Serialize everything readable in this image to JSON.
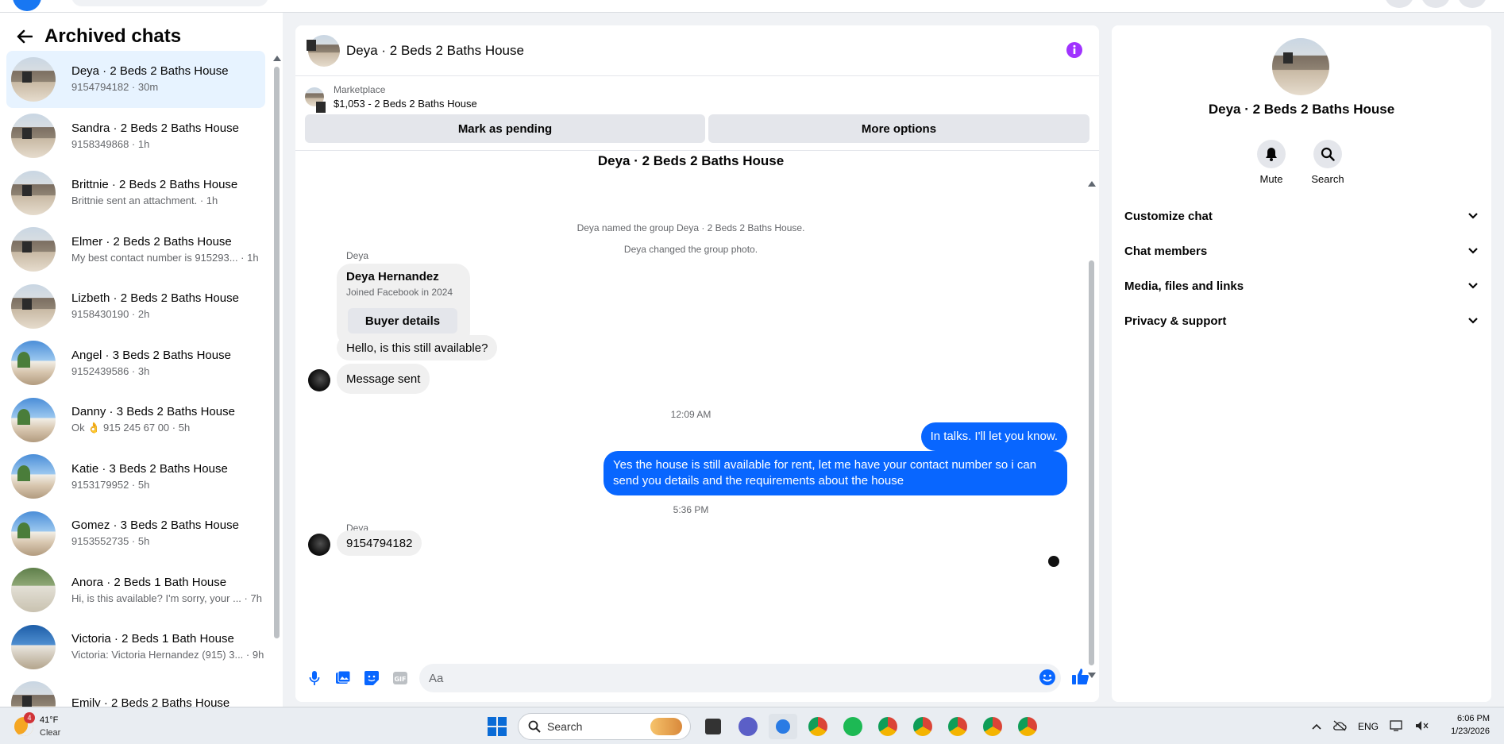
{
  "sidebar": {
    "title": "Archived chats",
    "chats": [
      {
        "name": "Deya · 2 Beds 2 Baths House",
        "sub": "9154794182 · 30m",
        "avatar": "house",
        "active": true
      },
      {
        "name": "Sandra · 2 Beds 2 Baths House",
        "sub": "9158349868 · 1h",
        "avatar": "house"
      },
      {
        "name": "Brittnie · 2 Beds 2 Baths House",
        "sub": "Brittnie sent an attachment. · 1h",
        "avatar": "house"
      },
      {
        "name": "Elmer · 2 Beds 2 Baths House",
        "sub": "My best contact number is 915293... · 1h",
        "avatar": "house"
      },
      {
        "name": "Lizbeth · 2 Beds 2 Baths House",
        "sub": "9158430190 · 2h",
        "avatar": "house"
      },
      {
        "name": "Angel · 3 Beds 2 Baths House",
        "sub": "9152439586 · 3h",
        "avatar": "blue"
      },
      {
        "name": "Danny · 3 Beds 2 Baths House",
        "sub": "Ok 👌 915 245 67 00 · 5h",
        "avatar": "blue"
      },
      {
        "name": "Katie · 3 Beds 2 Baths House",
        "sub": "9153179952 · 5h",
        "avatar": "blue"
      },
      {
        "name": "Gomez · 3 Beds 2 Baths House",
        "sub": "9153552735 · 5h",
        "avatar": "blue"
      },
      {
        "name": "Anora · 2 Beds 1 Bath House",
        "sub": "Hi, is this available? I'm sorry, your ... · 7h",
        "avatar": "green"
      },
      {
        "name": "Victoria · 2 Beds 1 Bath House",
        "sub": "Victoria: Victoria Hernandez (915) 3... · 9h",
        "avatar": "dusk"
      },
      {
        "name": "Emily · 2 Beds 2 Baths House",
        "sub": "",
        "avatar": "house"
      }
    ]
  },
  "chat": {
    "title": "Deya · 2 Beds 2 Baths House",
    "marketplace_label": "Marketplace",
    "listing": "$1,053 - 2 Beds 2 Baths House",
    "btn_pending": "Mark as pending",
    "btn_more": "More options",
    "thread_title": "Deya · 2 Beds 2 Baths House",
    "sys1": "Deya named the group Deya · 2 Beds 2 Baths House.",
    "sys2": "Deya changed the group photo.",
    "sender1": "Deya",
    "card_name": "Deya Hernandez",
    "card_sub": "Joined Facebook in 2024",
    "card_btn": "Buyer details",
    "msg_in1": "Hello, is this still available?",
    "msg_in2": "Message sent",
    "time1": "12:09 AM",
    "msg_out1": "In talks. I'll let you know.",
    "msg_out2": "Yes the house is still available for rent, let me have your contact number so i can send you details and the requirements about the house",
    "time2": "5:36 PM",
    "sender2": "Deya",
    "msg_in3": "9154794182",
    "composer_placeholder": "Aa"
  },
  "right": {
    "name": "Deya · 2 Beds 2 Baths House",
    "mute": "Mute",
    "search": "Search",
    "sections": [
      "Customize chat",
      "Chat members",
      "Media, files and links",
      "Privacy & support"
    ]
  },
  "taskbar": {
    "weather_badge": "4",
    "temp": "41°F",
    "condition": "Clear",
    "search": "Search",
    "lang": "ENG",
    "time": "6:06 PM",
    "date": "1/23/2026"
  },
  "colors": {
    "accent": "#0866ff",
    "info": "#a033ff"
  }
}
